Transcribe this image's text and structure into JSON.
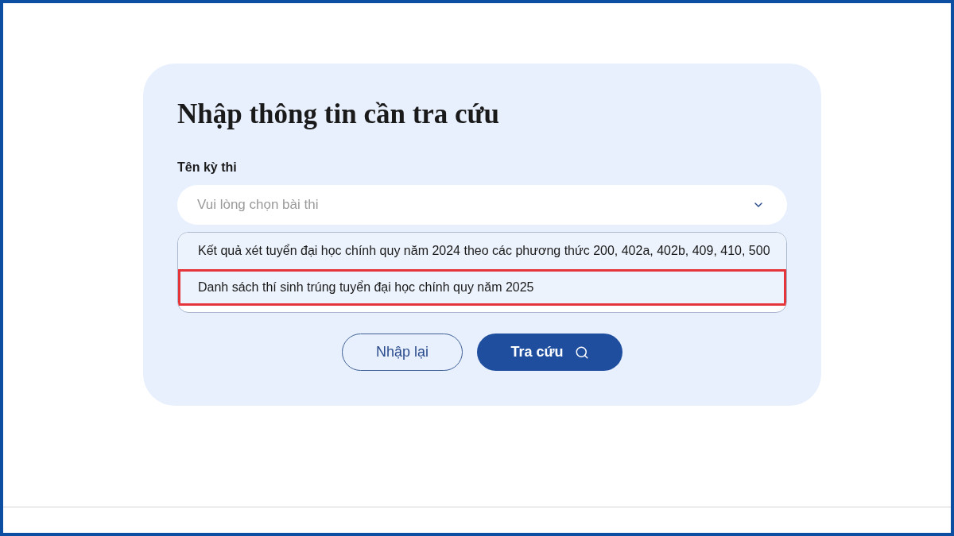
{
  "form": {
    "title": "Nhập thông tin cần tra cứu",
    "field": {
      "label": "Tên kỳ thi",
      "placeholder": "Vui lòng chọn bài thi",
      "expanded": true
    },
    "options": [
      {
        "label": "Kết quả xét tuyển đại học chính quy năm 2024 theo các phương thức 200, 402a, 402b, 409, 410, 500",
        "highlighted": false
      },
      {
        "label": "Danh sách thí sinh trúng tuyển đại học chính quy năm 2025",
        "highlighted": true
      }
    ],
    "buttons": [
      {
        "label": "Nhập lại",
        "kind": "outline"
      },
      {
        "label": "Tra cứu",
        "kind": "primary"
      }
    ]
  }
}
